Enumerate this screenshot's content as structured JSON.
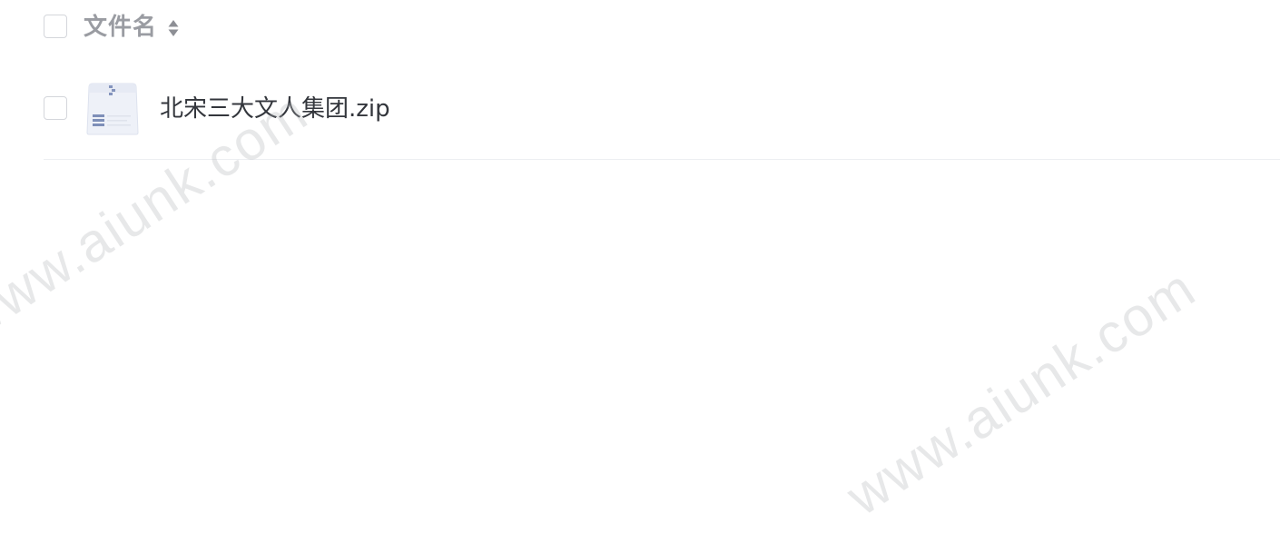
{
  "header": {
    "column_label": "文件名",
    "sort_icon": "sort-icon"
  },
  "files": [
    {
      "name": "北宋三大文人集团.zip",
      "icon": "zip-file-icon",
      "selected": false
    }
  ],
  "watermark": {
    "text": "www.aiunk.com"
  },
  "colors": {
    "header_text": "#9a9ca2",
    "file_text": "#33363c",
    "checkbox_border": "#d4d6db",
    "divider": "#eceef1",
    "icon_blue": "#7e8fb8"
  }
}
